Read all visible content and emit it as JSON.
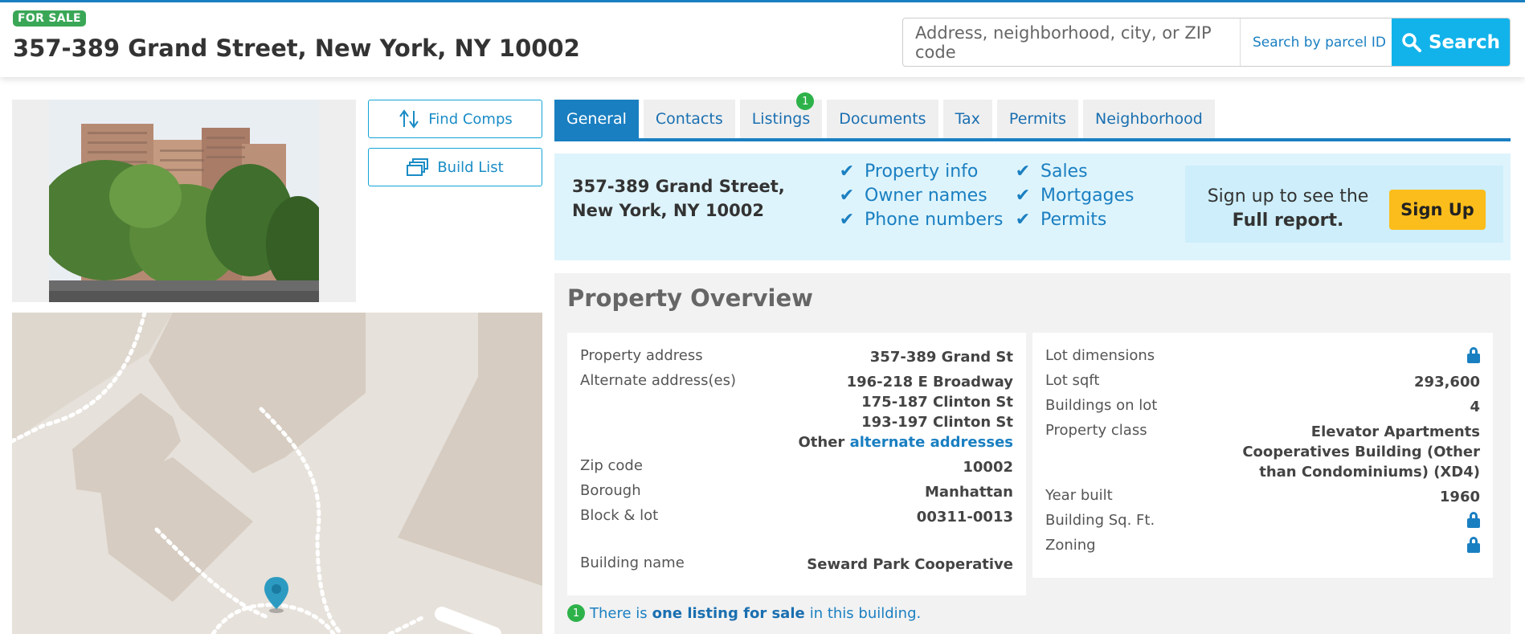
{
  "header": {
    "badge": "FOR SALE",
    "title": "357-389 Grand Street, New York, NY 10002",
    "search": {
      "address_placeholder": "Address, neighborhood, city, or ZIP code",
      "parcel_placeholder": "Search by parcel ID",
      "button": "Search"
    }
  },
  "actions": {
    "find_comps": "Find Comps",
    "build_list": "Build List"
  },
  "tabs": [
    {
      "label": "General",
      "active": true
    },
    {
      "label": "Contacts"
    },
    {
      "label": "Listings",
      "count": "1"
    },
    {
      "label": "Documents"
    },
    {
      "label": "Tax"
    },
    {
      "label": "Permits"
    },
    {
      "label": "Neighborhood"
    }
  ],
  "promo": {
    "address": "357-389 Grand Street, New York, NY 10002",
    "features_col1": [
      "Property info",
      "Owner names",
      "Phone numbers"
    ],
    "features_col2": [
      "Sales",
      "Mortgages",
      "Permits"
    ],
    "signup_line1": "Sign up to see the",
    "signup_line2": "Full report.",
    "signup_button": "Sign Up"
  },
  "overview": {
    "title": "Property Overview",
    "left": {
      "property_address": {
        "label": "Property address",
        "value": "357-389 Grand St"
      },
      "alternate": {
        "label": "Alternate address(es)",
        "values": [
          "196-218 E Broadway",
          "175-187 Clinton St",
          "193-197 Clinton St"
        ],
        "other_prefix": "Other",
        "other_link": "alternate addresses"
      },
      "zip": {
        "label": "Zip code",
        "value": "10002"
      },
      "borough": {
        "label": "Borough",
        "value": "Manhattan"
      },
      "block_lot": {
        "label": "Block & lot",
        "value": "00311-0013"
      },
      "building_name": {
        "label": "Building name",
        "value": "Seward Park Cooperative"
      }
    },
    "right": {
      "lot_dimensions": {
        "label": "Lot dimensions",
        "locked": true
      },
      "lot_sqft": {
        "label": "Lot sqft",
        "value": "293,600"
      },
      "buildings": {
        "label": "Buildings on lot",
        "value": "4"
      },
      "property_class": {
        "label": "Property class",
        "lines": [
          "Elevator Apartments",
          "Cooperatives Building (Other",
          "than Condominiums) (XD4)"
        ]
      },
      "year_built": {
        "label": "Year built",
        "value": "1960"
      },
      "building_sqft": {
        "label": "Building Sq. Ft.",
        "locked": true
      },
      "zoning": {
        "label": "Zoning",
        "locked": true
      }
    },
    "note": {
      "count": "1",
      "text1": "There is",
      "link": "one listing for sale",
      "text2": "in this building."
    }
  },
  "colors": {
    "brand_blue": "#1a7fc1",
    "search_button": "#12b3ea",
    "badge_green": "#3aa757",
    "signup_yellow": "#fbbd1b",
    "promo_bg": "#def4fc"
  }
}
